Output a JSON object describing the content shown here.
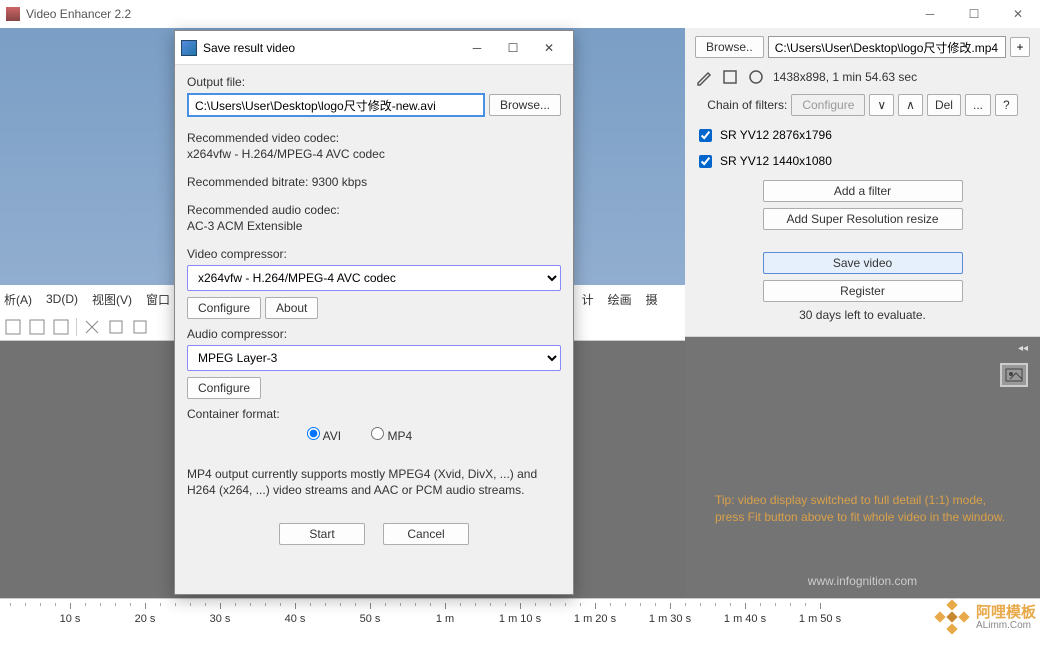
{
  "titlebar": {
    "title": "Video Enhancer 2.2"
  },
  "left": {
    "menu_items": [
      "析(A)",
      "3D(D)",
      "视图(V)",
      "窗口"
    ],
    "cn_icons": [
      "计",
      "绘画",
      "摄"
    ]
  },
  "dialog": {
    "title": "Save result video",
    "output_label": "Output file:",
    "output_value": "C:\\Users\\User\\Desktop\\logo尺寸修改-new.avi",
    "browse": "Browse...",
    "rec_vcodec_label": "Recommended video codec:",
    "rec_vcodec_val": "x264vfw - H.264/MPEG-4 AVC codec",
    "rec_bitrate": "Recommended bitrate: 9300 kbps",
    "rec_acodec_label": "Recommended audio codec:",
    "rec_acodec_val": "AC-3 ACM Extensible",
    "vcomp_label": "Video compressor:",
    "vcomp_val": "x264vfw - H.264/MPEG-4 AVC codec",
    "acomp_label": "Audio compressor:",
    "acomp_val": "MPEG Layer-3",
    "configure": "Configure",
    "about": "About",
    "container_label": "Container format:",
    "fmt_avi": "AVI",
    "fmt_mp4": "MP4",
    "mp4_note1": "MP4 output currently supports mostly MPEG4 (Xvid, DivX, ...) and",
    "mp4_note2": "H264 (x264, ...) video streams and AAC or PCM audio streams.",
    "start": "Start",
    "cancel": "Cancel"
  },
  "right": {
    "browse": "Browse..",
    "path": "C:\\Users\\User\\Desktop\\logo尺寸修改.mp4",
    "plus": "+",
    "info": "1438x898, 1 min 54.63 sec",
    "chain_label": "Chain of filters:",
    "configure": "Configure",
    "v": "∨",
    "caret": "∧",
    "del": "Del",
    "dots": "...",
    "q": "?",
    "filter1": "SR YV12 2876x1796",
    "filter2": "SR YV12 1440x1080",
    "add_filter": "Add a filter",
    "add_super": "Add Super Resolution resize",
    "save": "Save video",
    "register": "Register",
    "trial": "30 days left to evaluate.",
    "tip": "Tip: video display switched to full detail (1:1) mode, press Fit button above to fit whole video in the window.",
    "footer": "www.infognition.com"
  },
  "timeline": {
    "labels": [
      "10 s",
      "20 s",
      "30 s",
      "40 s",
      "50 s",
      "1 m",
      "1 m 10 s",
      "1 m 20 s",
      "1 m 30 s",
      "1 m 40 s",
      "1 m 50 s"
    ]
  },
  "watermark": {
    "title": "阿哩模板",
    "sub": "ALimm.Com"
  }
}
